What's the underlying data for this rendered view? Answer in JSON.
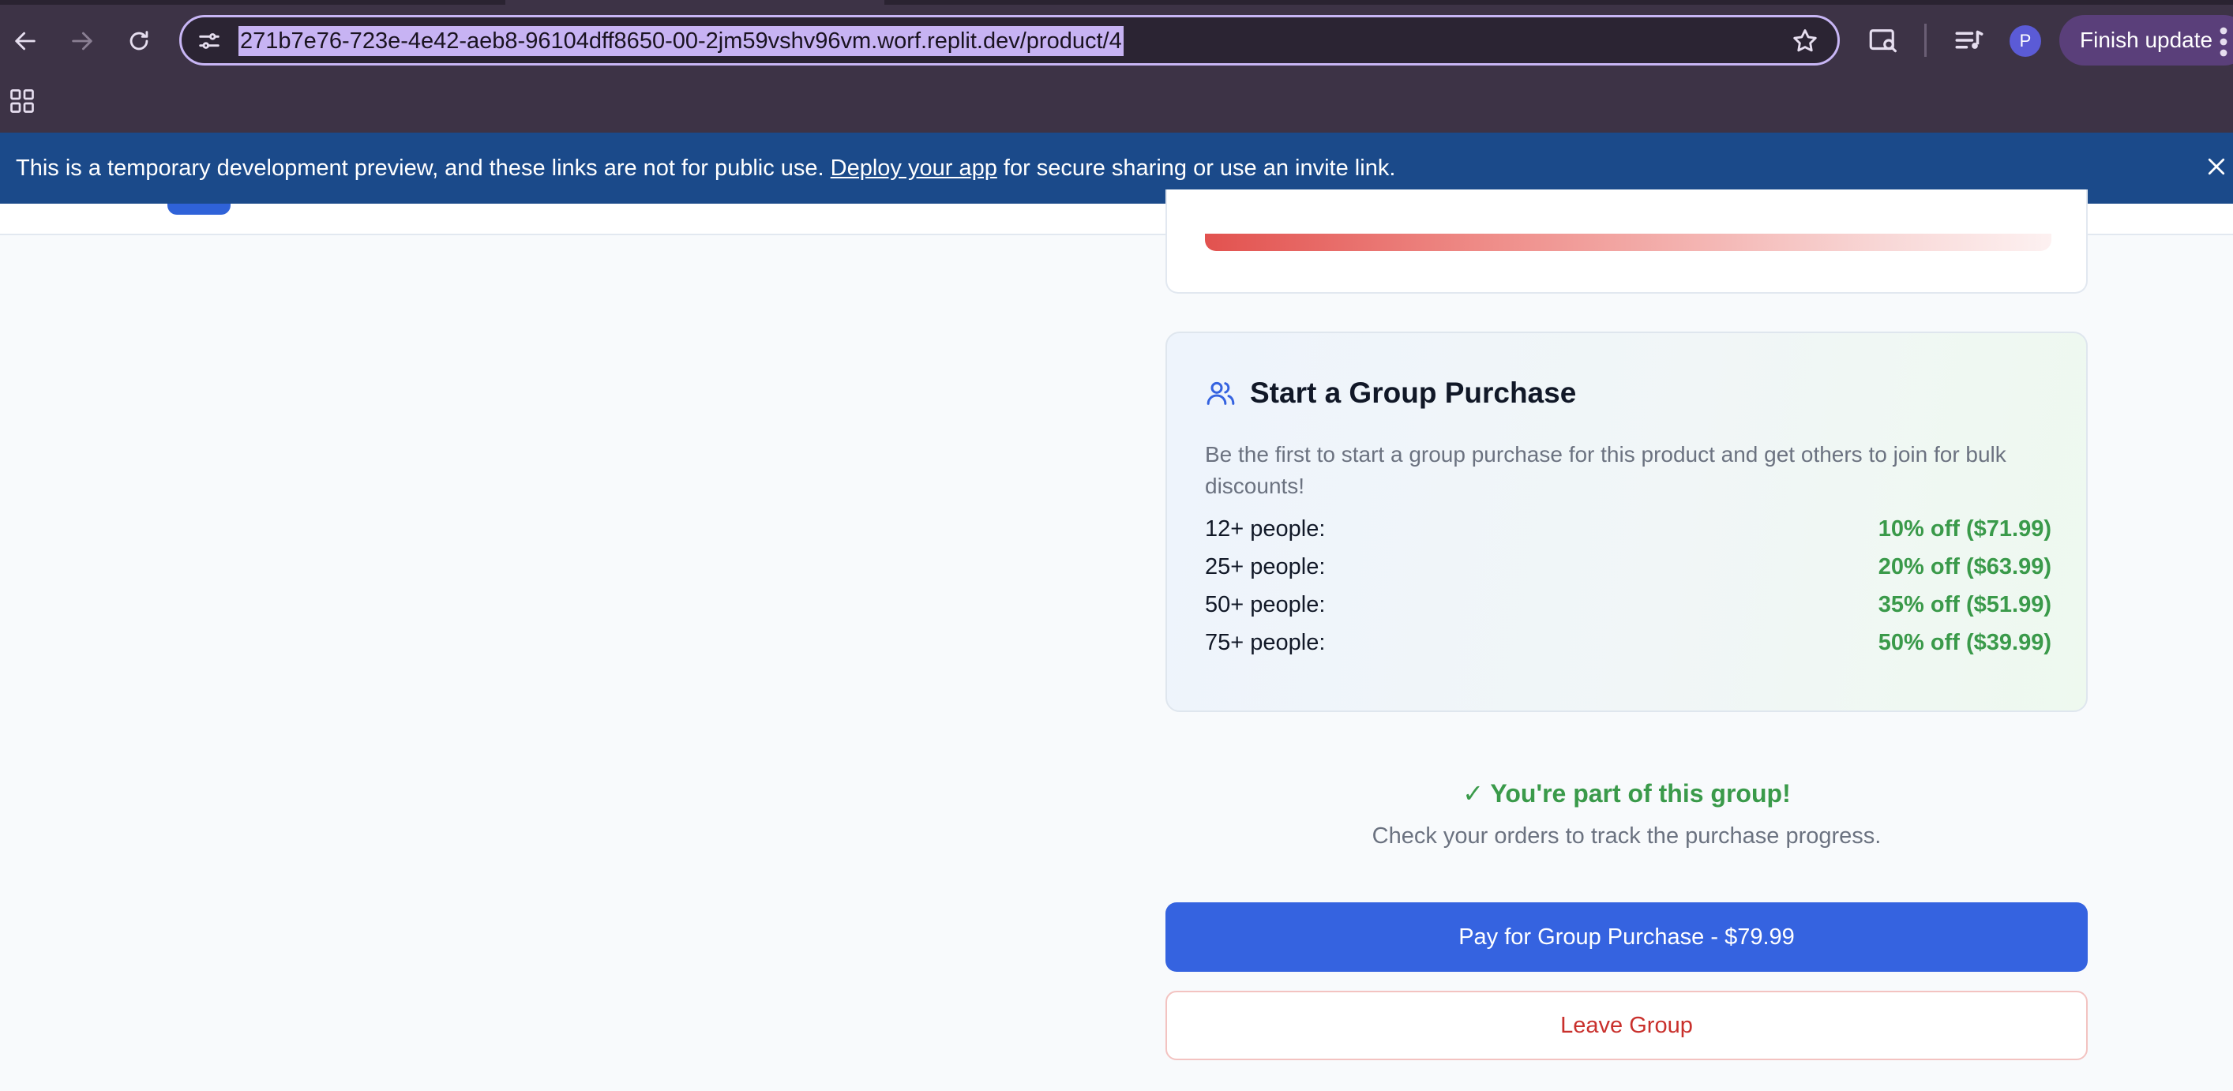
{
  "browser": {
    "url": "271b7e76-723e-4e42-aeb8-96104dff8650-00-2jm59vshv96vm.worf.replit.dev/product/4",
    "profile_initial": "P",
    "finish_update_label": "Finish update",
    "icons": [
      "back-arrow-icon",
      "forward-arrow-icon",
      "reload-icon",
      "site-settings-icon",
      "bookmark-star-icon",
      "tab-search-icon",
      "media-controls-icon",
      "menu-icon",
      "apps-grid-icon"
    ]
  },
  "banner": {
    "text_before": "This is a temporary development preview, and these links are not for public use.",
    "link_text": "Deploy your app",
    "text_after": "for secure sharing or use an invite link."
  },
  "group_purchase": {
    "title": "Start a Group Purchase",
    "description": "Be the first to start a group purchase for this product and get others to join for bulk discounts!",
    "tiers": [
      {
        "label": "12+ people:",
        "value": "10% off ($71.99)"
      },
      {
        "label": "25+ people:",
        "value": "20% off ($63.99)"
      },
      {
        "label": "50+ people:",
        "value": "35% off ($51.99)"
      },
      {
        "label": "75+ people:",
        "value": "50% off ($39.99)"
      }
    ]
  },
  "status": {
    "title": "✓ You're part of this group!",
    "subtitle": "Check your orders to track the purchase progress."
  },
  "actions": {
    "pay_label": "Pay for Group Purchase - $79.99",
    "leave_label": "Leave Group"
  },
  "colors": {
    "accent": "#3563e0",
    "success": "#3a9a4a",
    "danger": "#c9302c",
    "banner": "#1b4a8a"
  }
}
